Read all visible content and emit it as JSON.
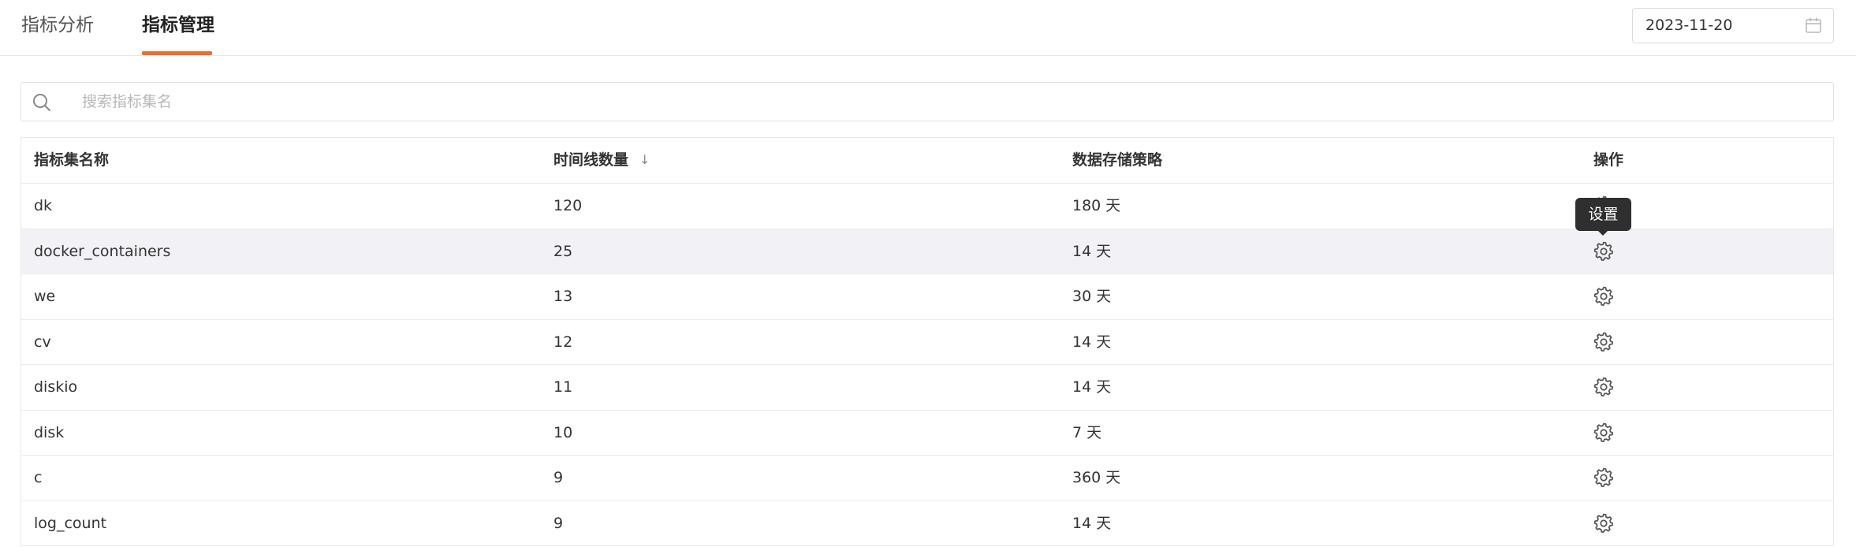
{
  "tabs": [
    {
      "label": "指标分析",
      "active": false
    },
    {
      "label": "指标管理",
      "active": true
    }
  ],
  "accent_color": "#ef6d2c",
  "date_picker": {
    "value": "2023-11-20",
    "icon": "calendar-icon"
  },
  "search": {
    "placeholder": "搜索指标集名",
    "value": "",
    "icon": "search-icon"
  },
  "table": {
    "columns": [
      "指标集名称",
      "时间线数量",
      "数据存储策略",
      "操作"
    ],
    "sort_icon": "↓",
    "rows": [
      {
        "name": "dk",
        "count": "120",
        "retention": "180 天"
      },
      {
        "name": "docker_containers",
        "count": "25",
        "retention": "14 天"
      },
      {
        "name": "we",
        "count": "13",
        "retention": "30 天"
      },
      {
        "name": "cv",
        "count": "12",
        "retention": "14 天"
      },
      {
        "name": "diskio",
        "count": "11",
        "retention": "14 天"
      },
      {
        "name": "disk",
        "count": "10",
        "retention": "7 天"
      },
      {
        "name": "c",
        "count": "9",
        "retention": "360 天"
      },
      {
        "name": "log_count",
        "count": "9",
        "retention": "14 天"
      }
    ],
    "action_icon": "gear-icon"
  },
  "tooltip": {
    "text": "设置"
  }
}
